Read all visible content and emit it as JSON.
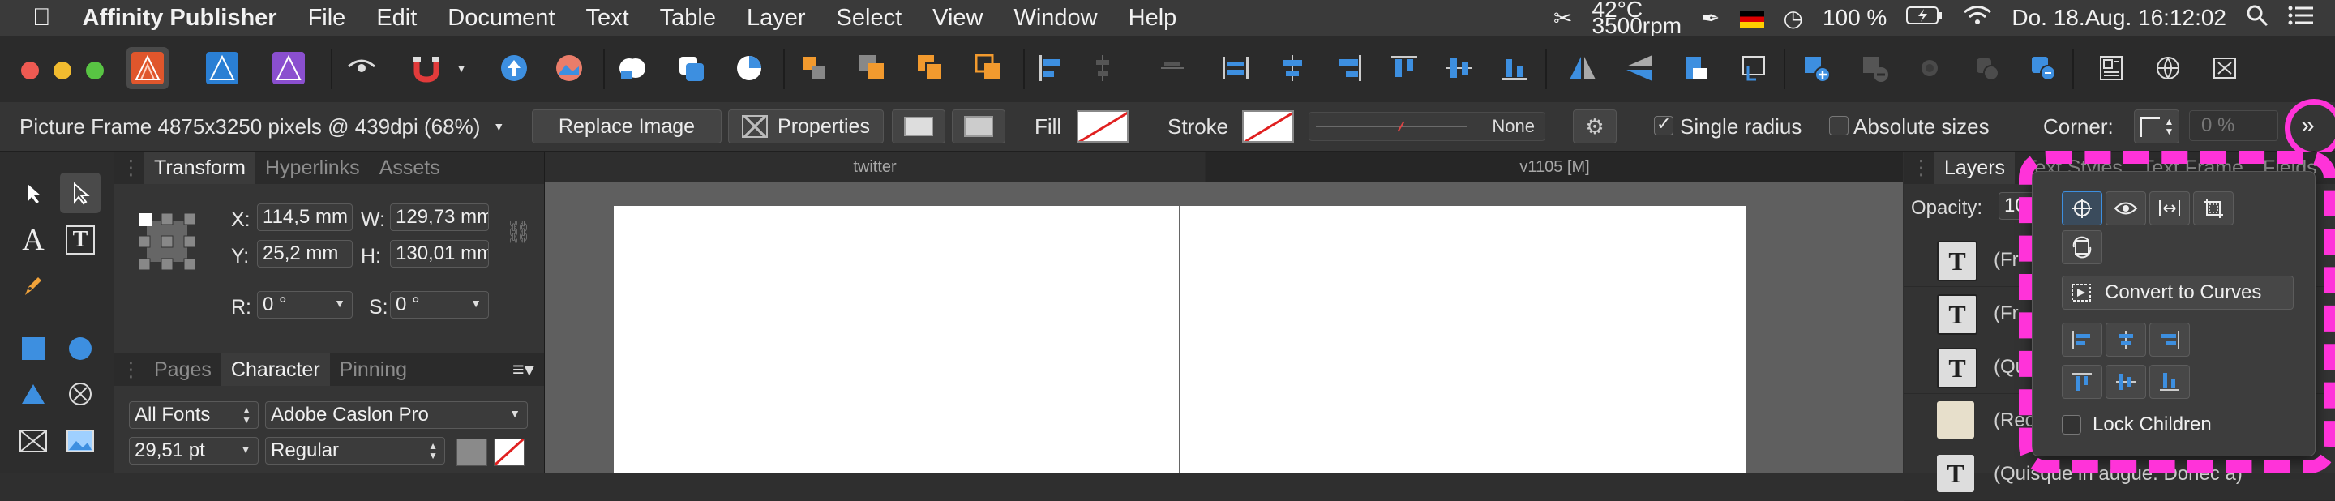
{
  "menubar": {
    "app_name": "Affinity Publisher",
    "menus": [
      "File",
      "Edit",
      "Document",
      "Text",
      "Table",
      "Layer",
      "Select",
      "View",
      "Window",
      "Help"
    ],
    "status": {
      "temperature": "42°C",
      "fan": "3500rpm",
      "battery": "100 %",
      "datetime": "Do. 18.Aug.  16:12:02"
    }
  },
  "context_toolbar": {
    "selection_info": "Picture Frame  4875x3250 pixels @ 439dpi (68%)",
    "replace_image_label": "Replace Image",
    "properties_label": "Properties",
    "fill_label": "Fill",
    "stroke_label": "Stroke",
    "stroke_style": "None",
    "single_radius_label": "Single radius",
    "absolute_sizes_label": "Absolute sizes",
    "corner_label": "Corner:",
    "corner_value": "0 %"
  },
  "left_panel": {
    "tabs": [
      "Transform",
      "Hyperlinks",
      "Assets"
    ],
    "transform": {
      "x_label": "X:",
      "x_value": "114,5 mm",
      "y_label": "Y:",
      "y_value": "25,2 mm",
      "w_label": "W:",
      "w_value": "129,73 mm",
      "h_label": "H:",
      "h_value": "130,01 mm",
      "r_label": "R:",
      "r_value": "0 °",
      "s_label": "S:",
      "s_value": "0 °"
    },
    "lower_tabs": [
      "Pages",
      "Character",
      "Pinning"
    ],
    "character": {
      "font_collection": "All Fonts",
      "font_family": "Adobe Caslon Pro",
      "font_size": "29,51 pt",
      "font_style": "Regular"
    }
  },
  "document": {
    "tab_left": "twitter",
    "tab_right": "v1105  [M]"
  },
  "right_panel": {
    "tabs": [
      "Layers",
      "Text Styles",
      "Text Frame",
      "Fields"
    ],
    "opacity_label": "Opacity:",
    "opacity_value": "100 %",
    "layers": [
      {
        "name": "(Fr",
        "kind": "text"
      },
      {
        "name": "(Fr",
        "kind": "text"
      },
      {
        "name": "(Qu",
        "kind": "text"
      },
      {
        "name": "(Rec",
        "kind": "image"
      },
      {
        "name": "(Quisque in augue. Donec a)",
        "kind": "text"
      }
    ]
  },
  "popover": {
    "convert_to_curves_label": "Convert to Curves",
    "lock_children_label": "Lock Children"
  },
  "colors": {
    "highlight": "#ff33d9",
    "accent_blue": "#3d8fe0",
    "affinity_publisher": "#e0562c"
  }
}
